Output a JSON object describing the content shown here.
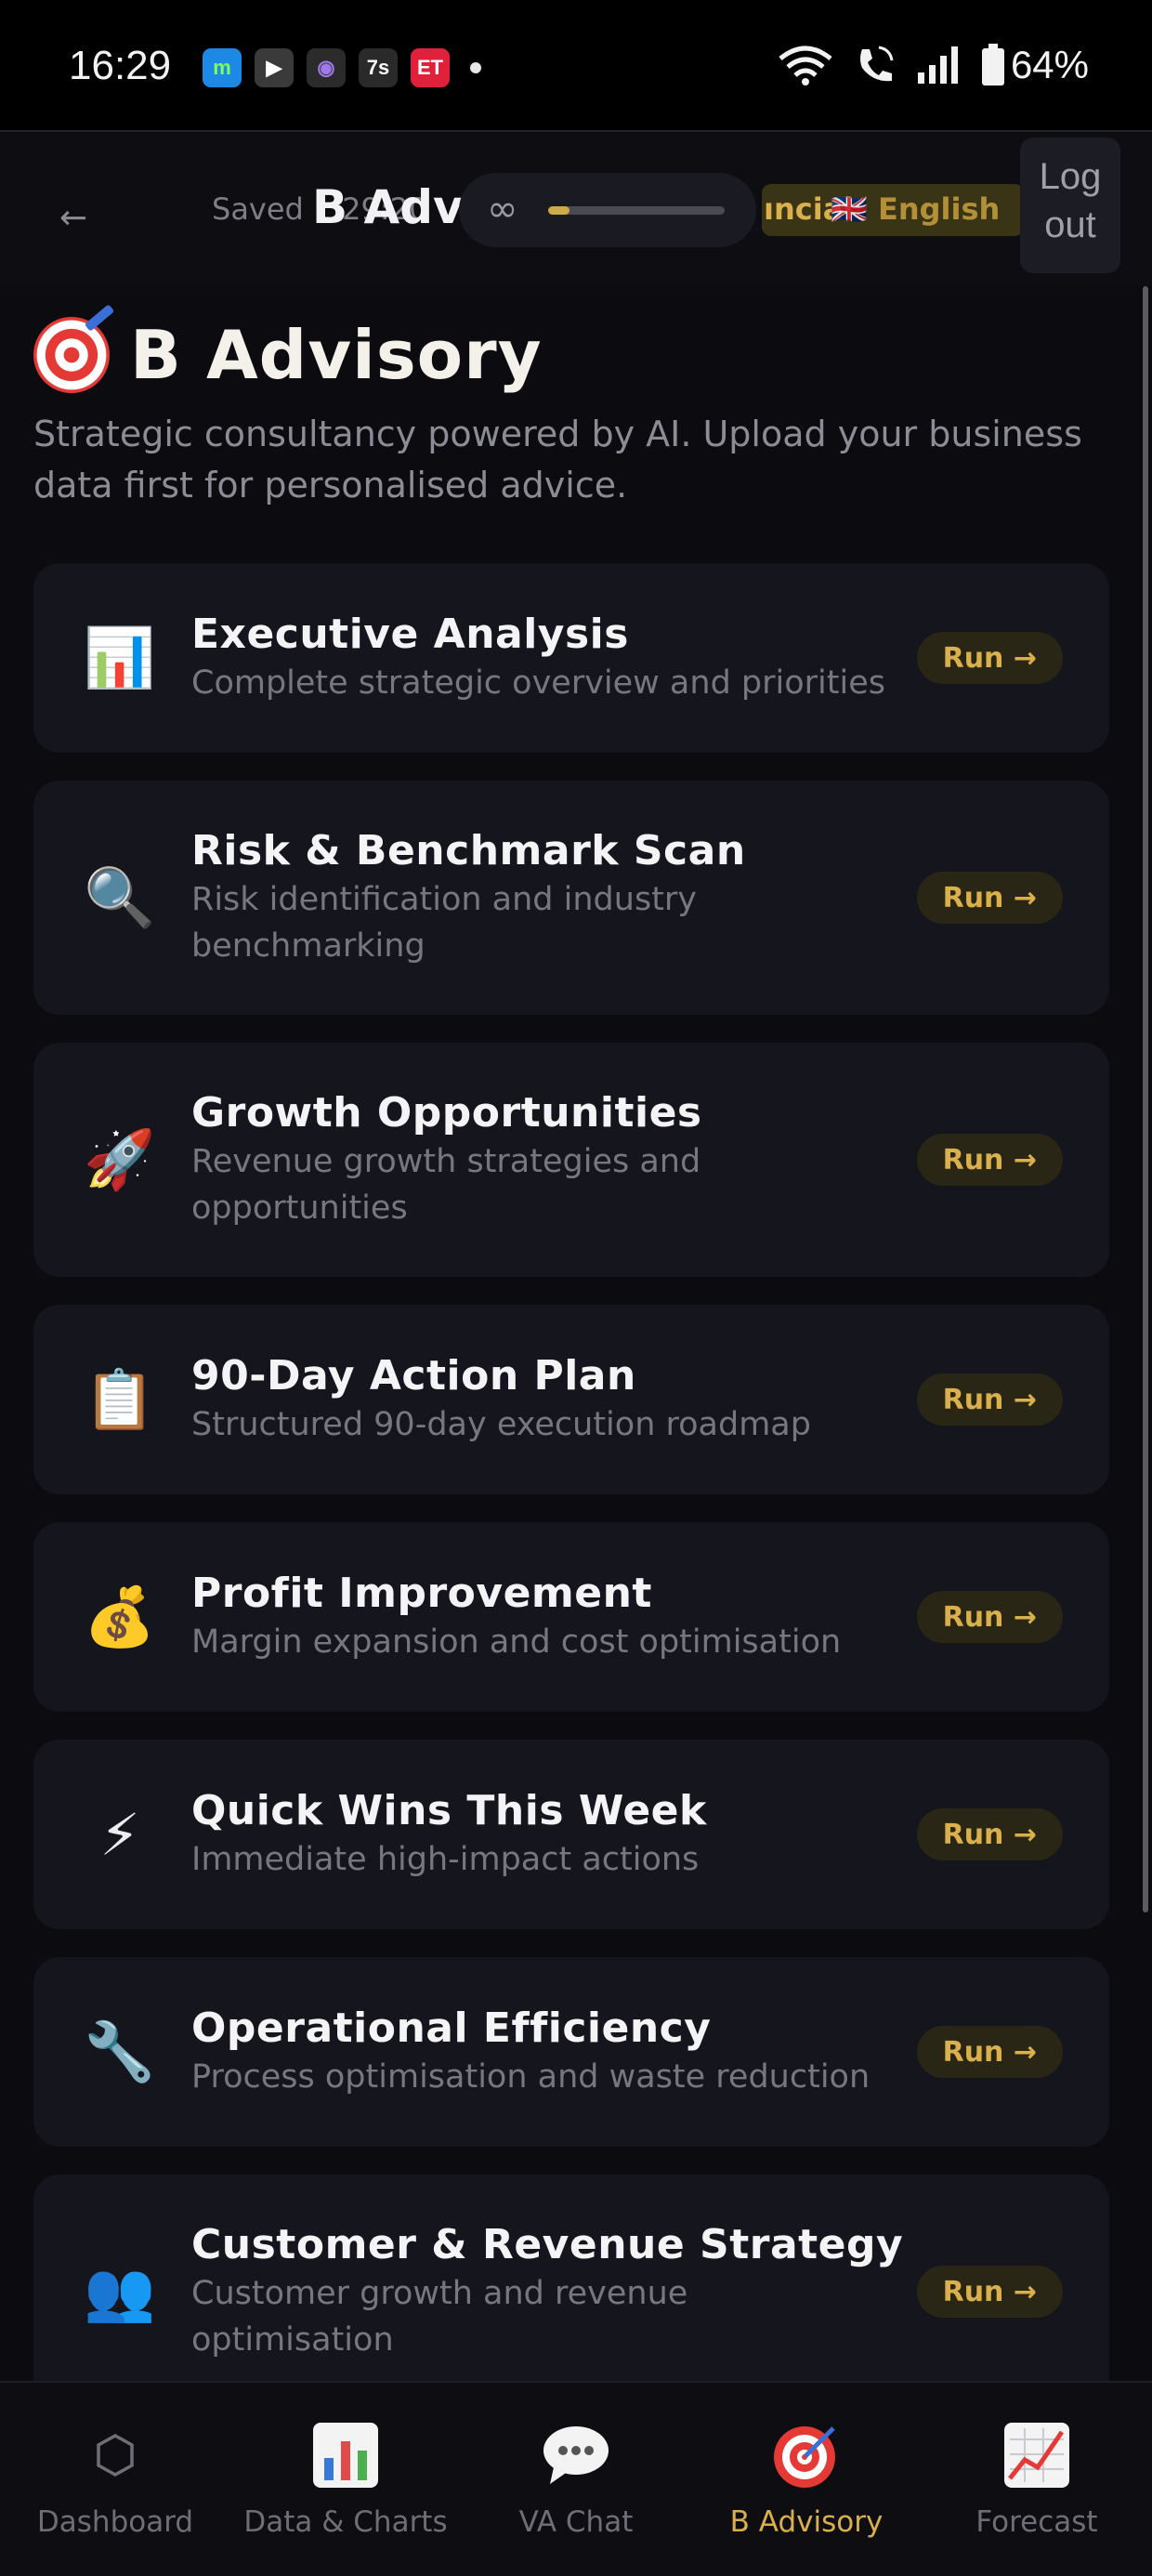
{
  "status_bar": {
    "time": "16:29",
    "battery": "64%",
    "apps": [
      {
        "name": "m-app",
        "label": "m",
        "bg": "#1e88e5",
        "fg": "#7cff5a"
      },
      {
        "name": "youtube",
        "label": "▶",
        "bg": "#3a3a3a",
        "fg": "#ffffff"
      },
      {
        "name": "chrome",
        "label": "◉",
        "bg": "#2b2b2b",
        "fg": "#a07ae8"
      },
      {
        "name": "7s-app",
        "label": "7s",
        "bg": "#2a2a2a",
        "fg": "#ffffff"
      },
      {
        "name": "et-app",
        "label": "ET",
        "bg": "#e0213b",
        "fg": "#ffffff"
      }
    ]
  },
  "header": {
    "back": "←",
    "forward": "→",
    "saved": "Saved 1:29:20",
    "title": "B Adv",
    "progress_symbol": "∞",
    "progress_fraction": 0.12,
    "language_overlap_a": "ıncial",
    "language_overlap_b": "🇬🇧 English",
    "logout_line1": "Log",
    "logout_line2": "out"
  },
  "page": {
    "title": "B Advisory",
    "subtitle": "Strategic consultancy powered by AI. Upload your business data first for personalised advice."
  },
  "cards": [
    {
      "icon": "bar-chart-icon",
      "emoji": "📊",
      "title": "Executive Analysis",
      "desc": "Complete strategic overview and priorities",
      "run": "Run →"
    },
    {
      "icon": "magnifier-icon",
      "emoji": "🔍",
      "title": "Risk & Benchmark Scan",
      "desc": "Risk identification and industry benchmarking",
      "run": "Run →"
    },
    {
      "icon": "rocket-icon",
      "emoji": "🚀",
      "title": "Growth Opportunities",
      "desc": "Revenue growth strategies and opportunities",
      "run": "Run →"
    },
    {
      "icon": "clipboard-icon",
      "emoji": "📋",
      "title": "90-Day Action Plan",
      "desc": "Structured 90-day execution roadmap",
      "run": "Run →"
    },
    {
      "icon": "money-bag-icon",
      "emoji": "💰",
      "title": "Profit Improvement",
      "desc": "Margin expansion and cost optimisation",
      "run": "Run →"
    },
    {
      "icon": "lightning-icon",
      "emoji": "⚡",
      "title": "Quick Wins This Week",
      "desc": "Immediate high-impact actions",
      "run": "Run →"
    },
    {
      "icon": "wrench-icon",
      "emoji": "🔧",
      "title": "Operational Efficiency",
      "desc": "Process optimisation and waste reduction",
      "run": "Run →"
    },
    {
      "icon": "people-icon",
      "emoji": "👥",
      "title": "Customer & Revenue Strategy",
      "desc": "Customer growth and revenue optimisation",
      "run": "Run →"
    }
  ],
  "nav": [
    {
      "label": "Dashboard",
      "icon": "hexagon-icon"
    },
    {
      "label": "Data & Charts",
      "icon": "bar-chart-icon"
    },
    {
      "label": "VA Chat",
      "icon": "speech-bubble-icon"
    },
    {
      "label": "B Advisory",
      "icon": "target-icon",
      "active": true
    },
    {
      "label": "Forecast",
      "icon": "trend-chart-icon"
    }
  ],
  "colors": {
    "accent": "#d9b04c",
    "background": "#0b0b10",
    "card": "#15151d"
  }
}
